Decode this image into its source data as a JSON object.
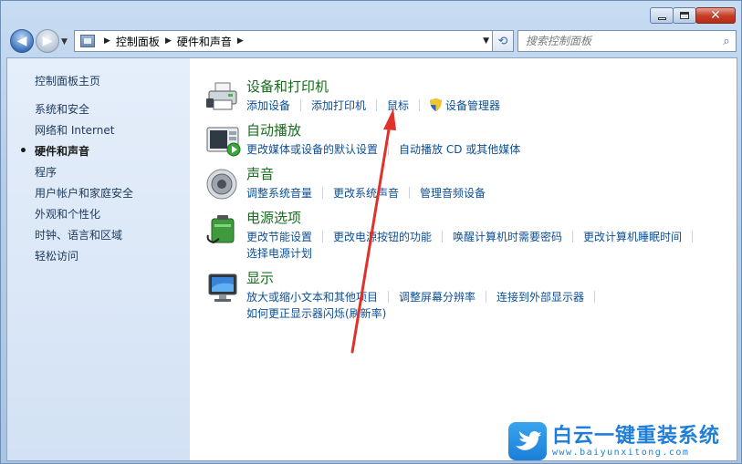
{
  "window": {
    "caption": {
      "minimize": "—",
      "maximize": "□",
      "close": "✕"
    }
  },
  "nav": {
    "breadcrumbs": [
      "控制面板",
      "硬件和声音"
    ],
    "search_placeholder": "搜索控制面板"
  },
  "sidebar": {
    "home": "控制面板主页",
    "items": [
      {
        "label": "系统和安全",
        "active": false
      },
      {
        "label": "网络和 Internet",
        "active": false
      },
      {
        "label": "硬件和声音",
        "active": true
      },
      {
        "label": "程序",
        "active": false
      },
      {
        "label": "用户帐户和家庭安全",
        "active": false
      },
      {
        "label": "外观和个性化",
        "active": false
      },
      {
        "label": "时钟、语言和区域",
        "active": false
      },
      {
        "label": "轻松访问",
        "active": false
      }
    ]
  },
  "categories": {
    "devices": {
      "title": "设备和打印机",
      "links": [
        "添加设备",
        "添加打印机",
        "鼠标",
        "设备管理器"
      ]
    },
    "autoplay": {
      "title": "自动播放",
      "links": [
        "更改媒体或设备的默认设置",
        "自动播放 CD 或其他媒体"
      ]
    },
    "sound": {
      "title": "声音",
      "links": [
        "调整系统音量",
        "更改系统声音",
        "管理音频设备"
      ]
    },
    "power": {
      "title": "电源选项",
      "links": [
        "更改节能设置",
        "更改电源按钮的功能",
        "唤醒计算机时需要密码",
        "更改计算机睡眠时间",
        "选择电源计划"
      ]
    },
    "display": {
      "title": "显示",
      "links": [
        "放大或缩小文本和其他项目",
        "调整屏幕分辨率",
        "连接到外部显示器",
        "如何更正显示器闪烁(刷新率)"
      ]
    }
  },
  "watermark": {
    "title": "白云一键重装系统",
    "url": "www.baiyunxitong.com"
  },
  "colors": {
    "category_title": "#196b1f",
    "link": "#0d4f95",
    "sidebar_bg": "#dbe7f7",
    "annotation_arrow": "#e0312a"
  }
}
